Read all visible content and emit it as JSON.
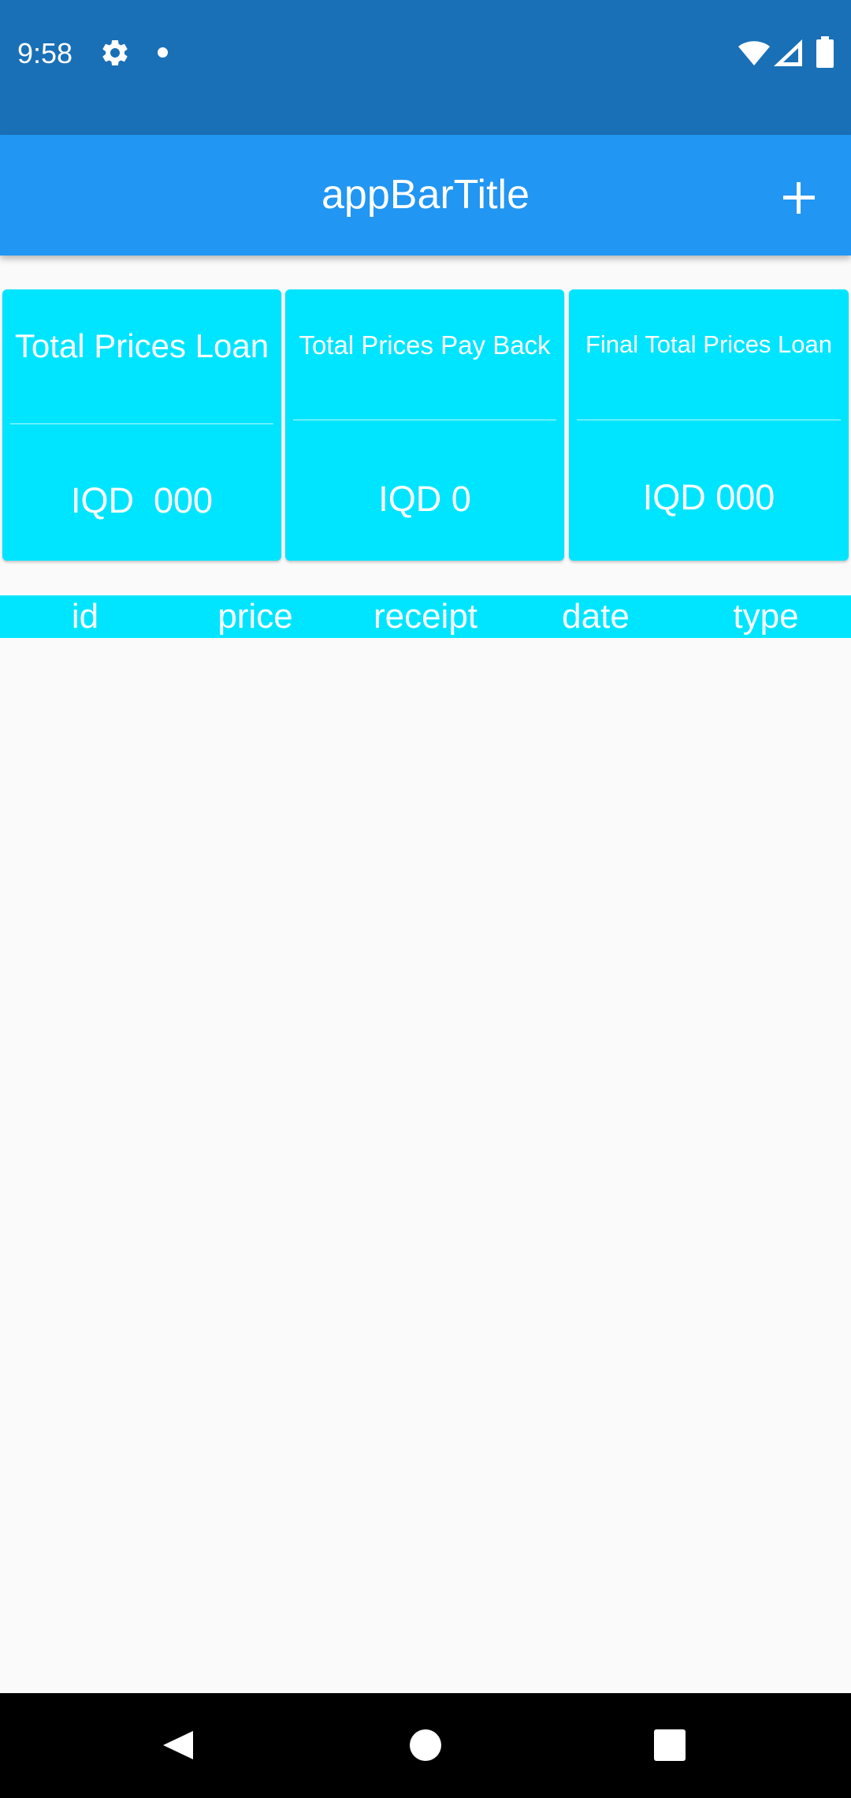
{
  "status_bar": {
    "time": "9:58",
    "icons": [
      "settings-icon",
      "notification-dot-icon",
      "wifi-icon",
      "signal-icon",
      "battery-icon"
    ]
  },
  "app_bar": {
    "title": "appBarTitle",
    "add_icon": "plus-icon"
  },
  "cards": [
    {
      "title": "Total Prices Loan",
      "value": "IQD  000"
    },
    {
      "title": "Total Prices Pay Back",
      "value": "IQD 0"
    },
    {
      "title": "Final Total Prices Loan",
      "value": "IQD 000"
    }
  ],
  "table": {
    "columns": [
      "id",
      "price",
      "receipt",
      "date",
      "type"
    ],
    "rows": []
  },
  "nav_bar": {
    "icons": [
      "back-icon",
      "home-icon",
      "recents-icon"
    ]
  },
  "colors": {
    "status_bar": "#1a70b7",
    "app_bar": "#2196f3",
    "card_accent": "#00e5ff",
    "background": "#fafafa",
    "nav_bar": "#000000"
  }
}
